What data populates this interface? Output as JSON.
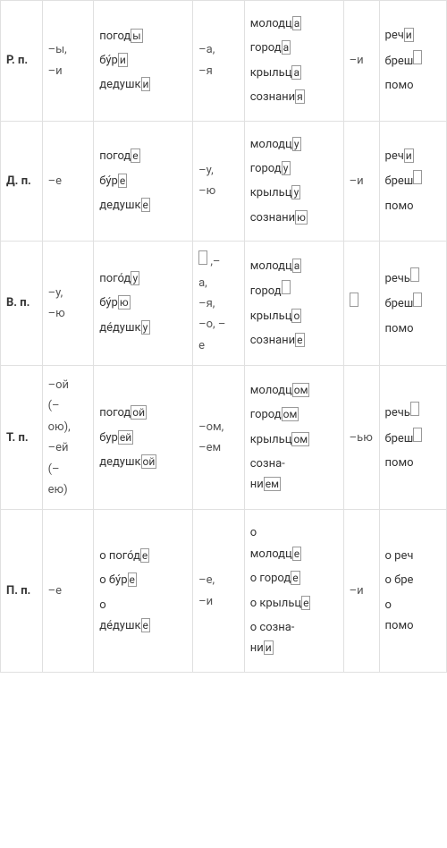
{
  "rows": [
    {
      "case": "Р. п.",
      "end1": "–ы,\n–и",
      "col1": [
        {
          "stem": "погод",
          "box": "ы"
        },
        {
          "stem": "бу́р",
          "box": "и"
        },
        {
          "stem": "дедушк",
          "box": "и"
        }
      ],
      "end2": "–а,\n–я",
      "col2": [
        {
          "stem": "молодц",
          "box": "а"
        },
        {
          "stem": "город",
          "box": "а"
        },
        {
          "stem": "крыльц",
          "box": "а"
        },
        {
          "stem": "сознани",
          "box": "я"
        }
      ],
      "end3": "–и",
      "col3": [
        {
          "stem": "реч",
          "box": "и"
        },
        {
          "stem": "бреш",
          "box": ""
        },
        {
          "stem": "помо",
          "box": null
        }
      ]
    },
    {
      "case": "Д. п.",
      "end1": "–е",
      "col1": [
        {
          "stem": "погод",
          "box": "е"
        },
        {
          "stem": "бу́р",
          "box": "е"
        },
        {
          "stem": "дедушк",
          "box": "е"
        }
      ],
      "end2": "–у,\n–ю",
      "col2": [
        {
          "stem": "молодц",
          "box": "у"
        },
        {
          "stem": "город",
          "box": "у"
        },
        {
          "stem": "крыльц",
          "box": "у"
        },
        {
          "stem": "сознани",
          "box": "ю"
        }
      ],
      "end3": "–и",
      "col3": [
        {
          "stem": "реч",
          "box": "и"
        },
        {
          "stem": "бреш",
          "box": ""
        },
        {
          "stem": "помо",
          "box": null
        }
      ]
    },
    {
      "case": "В. п.",
      "end1": "–у,\n–ю",
      "col1": [
        {
          "stem": "пого́д",
          "box": "у"
        },
        {
          "stem": "бу́р",
          "box": "ю"
        },
        {
          "stem": "де́душк",
          "box": "у"
        }
      ],
      "end2_pre": " ,–\nа,\n–я,\n–о, –\nе",
      "end2_box": "",
      "col2": [
        {
          "stem": "молодц",
          "box": "а"
        },
        {
          "stem": "город",
          "box": ""
        },
        {
          "stem": "крыльц",
          "box": "о"
        },
        {
          "stem": "сознани",
          "box": "е"
        }
      ],
      "end3_box": "",
      "col3": [
        {
          "stem": "речь",
          "box": ""
        },
        {
          "stem": "бреш",
          "box": ""
        },
        {
          "stem": "помо",
          "box": null
        }
      ]
    },
    {
      "case": "Т. п.",
      "end1": "–ой\n(–\nою),\n–ей\n(–\nею)",
      "col1": [
        {
          "stem": "погод",
          "box": "ой"
        },
        {
          "stem": "бур",
          "box": "ей"
        },
        {
          "stem": "дедушк",
          "box": "ой"
        }
      ],
      "end2": "–ом,\n–ем",
      "col2": [
        {
          "stem": "молодц",
          "box": "ом"
        },
        {
          "stem": "город",
          "box": "ом"
        },
        {
          "stem": "крыльц",
          "box": "ом"
        },
        {
          "stem": "созна-\nни",
          "box": "ем"
        }
      ],
      "end3": "–ью",
      "col3": [
        {
          "stem": "речь",
          "box": ""
        },
        {
          "stem": "бреш",
          "box": ""
        },
        {
          "stem": "помо",
          "box": null
        }
      ]
    },
    {
      "case": "П. п.",
      "end1": "–е",
      "col1": [
        {
          "stem": "о пого́д",
          "box": "е"
        },
        {
          "stem": "о бу́р",
          "box": "е"
        },
        {
          "stem": "о\nде́душк",
          "box": "е"
        }
      ],
      "end2": "–е,\n–и",
      "col2": [
        {
          "stem": "о\nмолодц",
          "box": "е"
        },
        {
          "stem": "о город",
          "box": "е"
        },
        {
          "stem": "о крыльц",
          "box": "е"
        },
        {
          "stem": "о созна-\nни",
          "box": "и"
        }
      ],
      "end3": "–и",
      "col3": [
        {
          "stem": "о реч",
          "box": null
        },
        {
          "stem": "о бре",
          "box": null
        },
        {
          "stem": "о\nпомо",
          "box": null
        }
      ]
    }
  ]
}
